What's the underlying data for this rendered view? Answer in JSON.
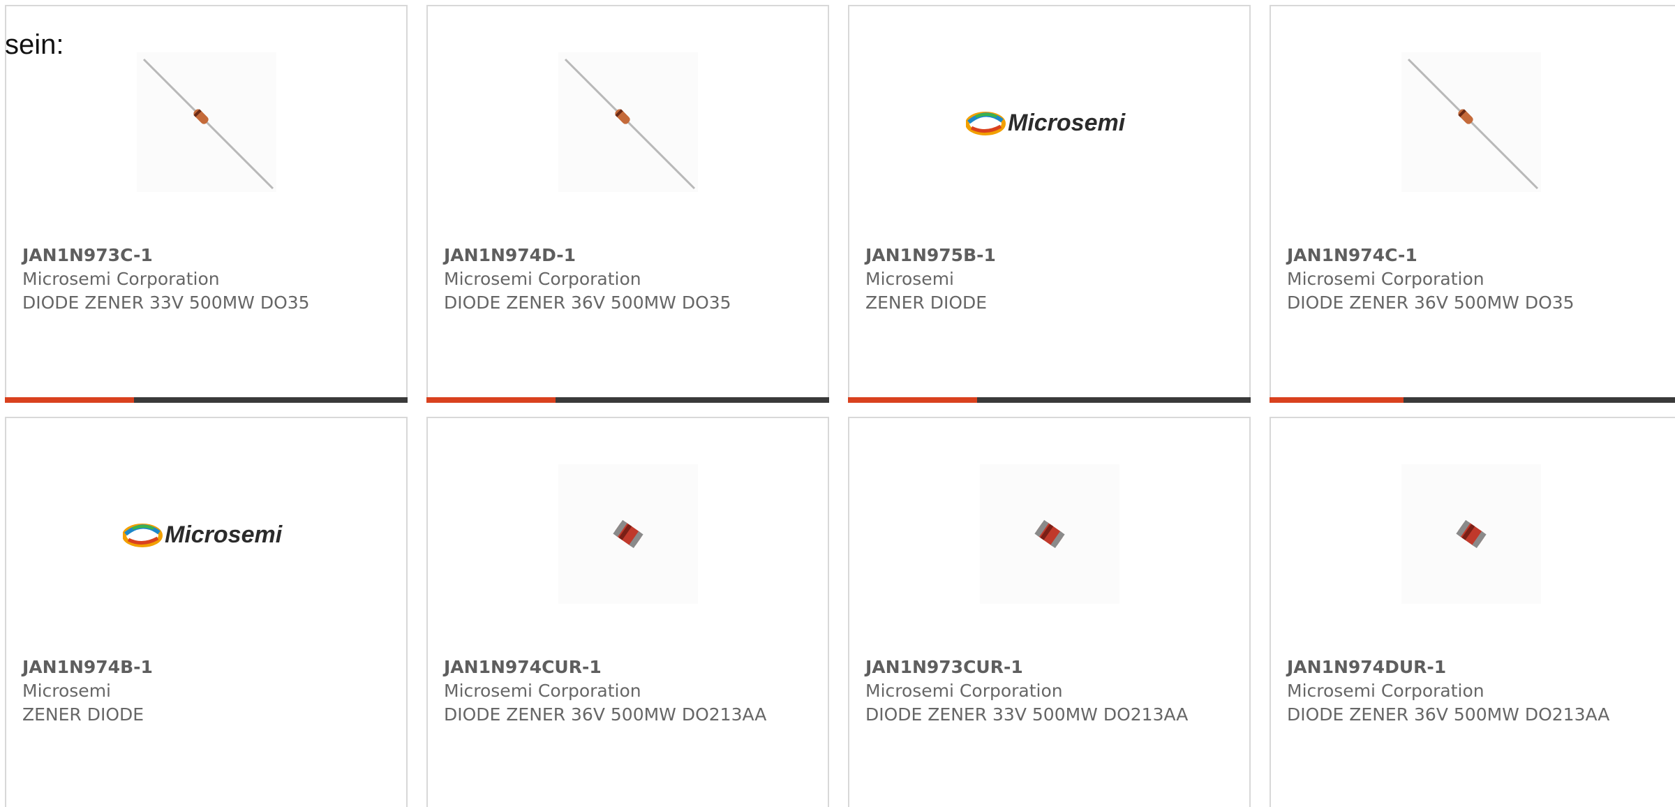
{
  "lead_text": "sein:",
  "accent_color": "#d9411e",
  "track_color": "#3a3a3a",
  "products": [
    {
      "part_number": "JAN1N973C-1",
      "manufacturer": "Microsemi Corporation",
      "description": "DIODE ZENER 33V 500MW DO35",
      "image": "axial-diode-icon",
      "progress_fraction": 0.32
    },
    {
      "part_number": "JAN1N974D-1",
      "manufacturer": "Microsemi Corporation",
      "description": "DIODE ZENER 36V 500MW DO35",
      "image": "axial-diode-icon",
      "progress_fraction": 0.32
    },
    {
      "part_number": "JAN1N975B-1",
      "manufacturer": "Microsemi",
      "description": "ZENER DIODE",
      "image": "microsemi-logo",
      "progress_fraction": 0.32
    },
    {
      "part_number": "JAN1N974C-1",
      "manufacturer": "Microsemi Corporation",
      "description": "DIODE ZENER 36V 500MW DO35",
      "image": "axial-diode-icon",
      "progress_fraction": 0.32
    },
    {
      "part_number": "JAN1N974B-1",
      "manufacturer": "Microsemi",
      "description": "ZENER DIODE",
      "image": "microsemi-logo"
    },
    {
      "part_number": "JAN1N974CUR-1",
      "manufacturer": "Microsemi Corporation",
      "description": "DIODE ZENER 36V 500MW DO213AA",
      "image": "melf-diode-icon"
    },
    {
      "part_number": "JAN1N973CUR-1",
      "manufacturer": "Microsemi Corporation",
      "description": "DIODE ZENER 33V 500MW DO213AA",
      "image": "melf-diode-icon"
    },
    {
      "part_number": "JAN1N974DUR-1",
      "manufacturer": "Microsemi Corporation",
      "description": "DIODE ZENER 36V 500MW DO213AA",
      "image": "melf-diode-icon"
    }
  ]
}
